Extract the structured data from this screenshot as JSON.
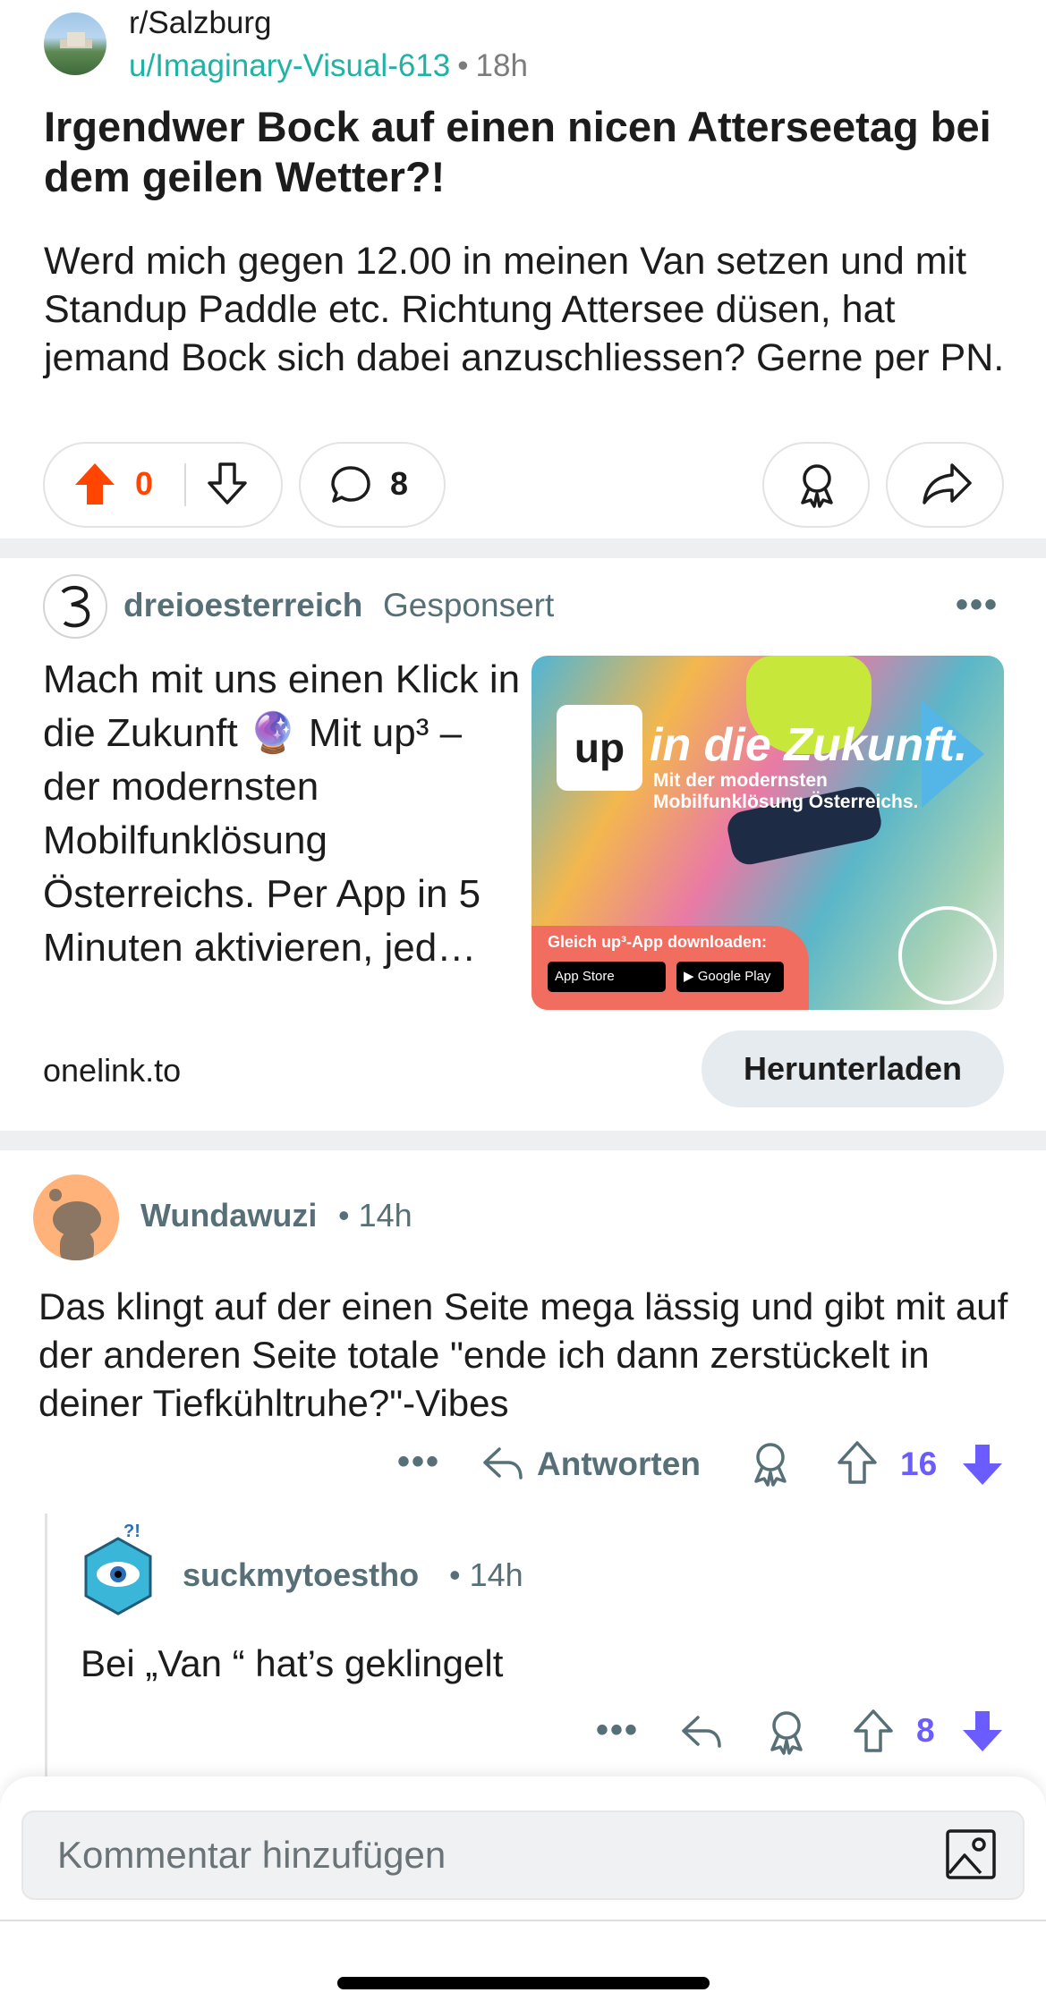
{
  "post": {
    "subreddit": "r/Salzburg",
    "author": "u/Imaginary-Visual-613",
    "separator": "•",
    "time": "18h",
    "title": "Irgendwer Bock auf einen nicen Atterseetag bei dem geilen Wetter?!",
    "body": "Werd mich gegen 12.00 in meinen Van setzen und mit Standup Paddle etc. Richtung Attersee düsen, hat jemand Bock sich dabei anzuschliessen? Gerne per PN.",
    "vote_count": "0",
    "comment_count": "8"
  },
  "ad": {
    "advertiser": "dreioesterreich",
    "sponsored_label": "Gesponsert",
    "more": "•••",
    "text": "Mach mit uns einen Klick in die Zukunft 🔮 Mit up³ – der modernsten Mobilfunklösung Österreichs. Per App in 5 Minuten aktivieren, jed…",
    "image": {
      "logo": "up",
      "headline": "in die Zukunft.",
      "sub_line1": "Mit der modernsten",
      "sub_line2": "Mobilfunklösung Österreichs.",
      "download_label": "Gleich up³-App downloaden:",
      "appstore_badge": " App Store",
      "googleplay_badge": "▶ Google Play"
    },
    "domain": "onelink.to",
    "cta": "Herunterladen"
  },
  "comments": [
    {
      "author": "Wundawuzi",
      "time": "• 14h",
      "body": "Das klingt auf der einen Seite mega lässig und gibt mit auf der anderen Seite totale \"ende ich dann zerstückelt in deiner Tiefkühltruhe?\"-Vibes",
      "more": "•••",
      "reply_label": "Antworten",
      "score": "16"
    },
    {
      "author": "suckmytoestho",
      "time": "• 14h",
      "body": "Bei „Van “ hat’s geklingelt",
      "more": "•••",
      "score": "8"
    }
  ],
  "composer": {
    "placeholder": "Kommentar hinzufügen"
  },
  "colors": {
    "upvote_active": "#ff4500",
    "downvote_active": "#6a5cff",
    "author_link": "#21b2a6",
    "meta": "#576f76"
  },
  "icons": [
    "upvote-icon",
    "downvote-icon",
    "comment-icon",
    "award-icon",
    "share-icon",
    "reply-icon",
    "image-icon"
  ]
}
